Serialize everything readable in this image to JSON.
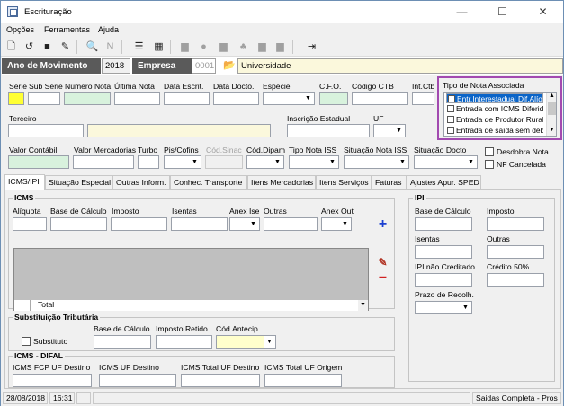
{
  "window": {
    "title": "Escrituração",
    "minimize": "—",
    "maximize": "☐",
    "close": "✕"
  },
  "menu": {
    "opcoes": "Opções",
    "ferramentas": "Ferramentas",
    "ajuda": "Ajuda"
  },
  "yearbar": {
    "ano_label": "Ano de Movimento",
    "ano_value": "2018",
    "empresa_label": "Empresa",
    "empresa_code": "0001",
    "empresa_name": "Universidade"
  },
  "header": {
    "serie": "Série",
    "sub_serie": "Sub Série",
    "numero_nota": "Número Nota",
    "ultima_nota": "Última Nota",
    "data_escrit": "Data Escrit.",
    "data_docto": "Data Docto.",
    "especie": "Espécie",
    "cfo": "C.F.O.",
    "codigo_ctb": "Código CTB",
    "int_ctb": "Int.Ctb",
    "tipo_nota_associada": "Tipo de Nota Associada",
    "terceiro": "Terceiro",
    "inscricao_estadual": "Inscrição Estadual",
    "uf": "UF",
    "valor_contabil": "Valor Contábil",
    "valor_mercadorias": "Valor Mercadorias",
    "turbo": "Turbo",
    "pis_cofins": "Pis/Cofins",
    "cod_sinac": "Cód.Sinac",
    "cod_dipam": "Cód.Dipam",
    "tipo_nota_iss": "Tipo Nota ISS",
    "situacao_nota_iss": "Situação Nota ISS",
    "situacao_docto": "Situação Docto",
    "desdobra_nota": "Desdobra Nota",
    "nf_cancelada": "NF Cancelada"
  },
  "tipo_nota_items": [
    "Entr.Interestadual Dif.Alíq",
    "Entrada com ICMS Diferido",
    "Entrada de Produtor Rural",
    "Entrada de saída sem débito"
  ],
  "tabs": [
    "ICMS/IPI",
    "Situação Especial",
    "Outras Inform.",
    "Conhec. Transporte",
    "Itens Mercadorias",
    "Itens Serviços",
    "Faturas",
    "Ajustes Apur. SPED"
  ],
  "icms": {
    "title": "ICMS",
    "aliquota": "Alíquota",
    "base_calculo": "Base de Cálculo",
    "imposto": "Imposto",
    "isentas": "Isentas",
    "anex_ise": "Anex Ise",
    "outras": "Outras",
    "anex_out": "Anex Out",
    "total": "Total"
  },
  "ipi": {
    "title": "IPI",
    "base_calculo": "Base de Cálculo",
    "imposto": "Imposto",
    "isentas": "Isentas",
    "outras": "Outras",
    "ipi_nao_creditado": "IPI não Creditado",
    "credito_50": "Crédito 50%",
    "prazo_recolh": "Prazo de Recolh."
  },
  "st": {
    "title": "Substituição Tributária",
    "substituto": "Substituto",
    "base_calculo": "Base de Cálculo",
    "imposto_retido": "Imposto Retido",
    "cod_antecip": "Cód.Antecip."
  },
  "difal": {
    "title": "ICMS - DIFAL",
    "fcp_uf_destino": "ICMS FCP UF Destino",
    "icms_uf_destino": "ICMS UF Destino",
    "total_uf_destino": "ICMS Total UF Destino",
    "total_uf_origem": "ICMS Total UF Origem"
  },
  "status": {
    "date": "28/08/2018",
    "time": "16:31",
    "message": "Saidas Completa - Pros"
  }
}
